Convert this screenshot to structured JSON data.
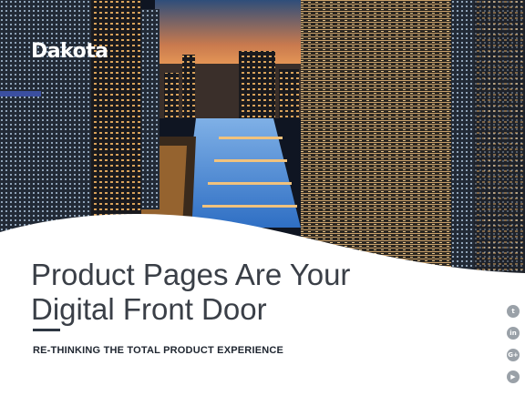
{
  "brand": {
    "logo_text": "Dakota"
  },
  "hero": {
    "headline_line1": "Product Pages Are Your",
    "headline_line2": "Digital Front Door",
    "subtitle": "RE-THINKING THE TOTAL PRODUCT EXPERIENCE"
  },
  "social": [
    {
      "icon": "twitter-icon",
      "glyph": "t"
    },
    {
      "icon": "linkedin-icon",
      "glyph": "in"
    },
    {
      "icon": "google-plus-icon",
      "glyph": "G+"
    },
    {
      "icon": "youtube-icon",
      "glyph": "▶"
    }
  ],
  "colors": {
    "headline": "#3a3f47",
    "subtitle": "#1f2630",
    "rule": "#2d3642",
    "social": "#9aa1a8",
    "sky": "#f29b4a",
    "night": "#0e1726"
  }
}
